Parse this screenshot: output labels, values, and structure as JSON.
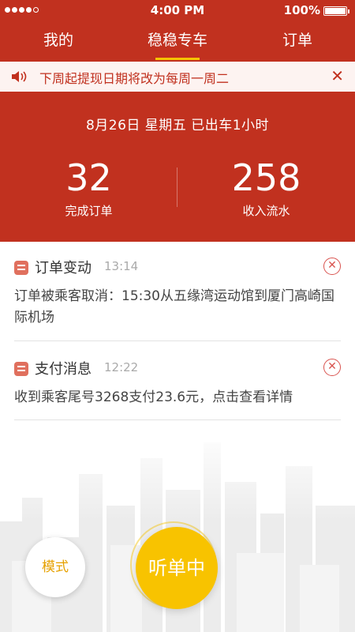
{
  "status_bar": {
    "time": "4:00 PM",
    "battery": "100%"
  },
  "tabs": [
    {
      "label": "我的"
    },
    {
      "label": "稳稳专车",
      "active": true
    },
    {
      "label": "订单"
    }
  ],
  "notice": {
    "text": "下周起提现日期将改为每周一周二",
    "close": "✕"
  },
  "summary": {
    "date_line": "8月26日   星期五   已出车1小时",
    "orders_value": "32",
    "orders_label": "完成订单",
    "income_value": "258",
    "income_label": "收入流水"
  },
  "messages": [
    {
      "title": "订单变动",
      "time": "13:14",
      "body": "订单被乘客取消：15:30从五缘湾运动馆到厦门高崎国际机场"
    },
    {
      "title": "支付消息",
      "time": "12:22",
      "body": "收到乘客尾号3268支付23.6元，点击查看详情"
    }
  ],
  "buttons": {
    "mode": "模式",
    "listen": "听单中"
  },
  "colors": {
    "brand_red": "#c1311f",
    "accent_yellow": "#f8c300"
  }
}
